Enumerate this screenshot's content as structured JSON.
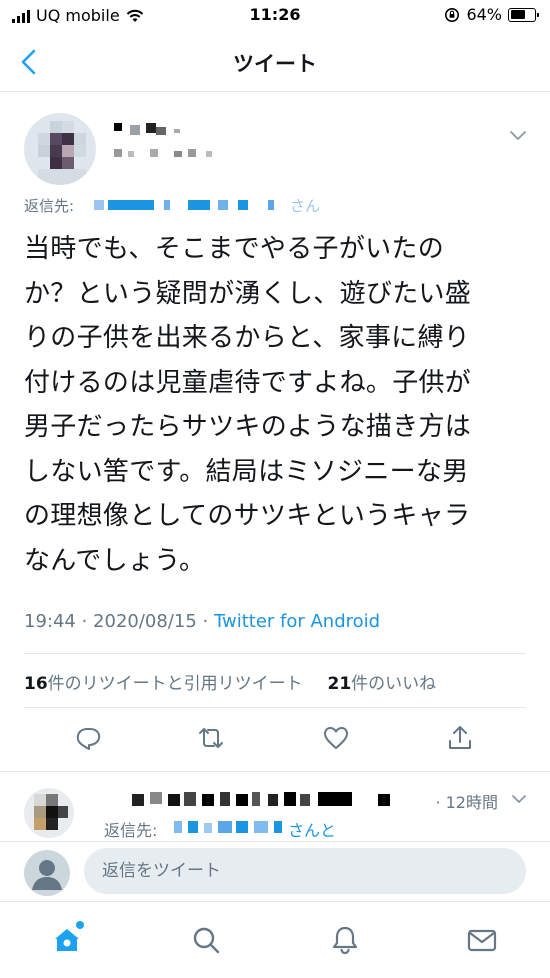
{
  "status_bar": {
    "carrier": "UQ mobile",
    "time": "11:26",
    "battery_percent_text": "64%",
    "battery_level": 0.64
  },
  "nav": {
    "title": "ツイート",
    "back_icon": "chevron-left-icon"
  },
  "tweet": {
    "reply_to_label": "返信先:",
    "reply_to_suffix": "さん",
    "text": "当時でも、そこまでやる子がいたの\nか？という疑問が湧くし、遊びたい盛\nりの子供を出来るからと、家事に縛り\n付けるのは児童虐待ですよね。子供が\n男子だったらサツキのような描き方は\nしない筈です。結局はミソジニーな男\nの理想像としてのサツキというキャラ\nなんでしょう。",
    "time": "19:44",
    "date": "2020/08/15",
    "separator": " · ",
    "source": "Twitter for Android",
    "retweet_count": "16",
    "retweet_label": "件のリツイートと引用リツイート",
    "like_count": "21",
    "like_label": "件のいいね"
  },
  "actions": [
    {
      "name": "reply",
      "icon": "reply-icon"
    },
    {
      "name": "retweet",
      "icon": "retweet-icon"
    },
    {
      "name": "like",
      "icon": "heart-icon"
    },
    {
      "name": "share",
      "icon": "share-icon"
    }
  ],
  "reply_preview": {
    "time": "· 12時間",
    "reply_to_label": "返信先:",
    "reply_to_suffix": "さんと"
  },
  "compose": {
    "placeholder": "返信をツイート"
  },
  "tabs": [
    {
      "name": "home",
      "icon": "home-icon"
    },
    {
      "name": "search",
      "icon": "search-icon"
    },
    {
      "name": "notifications",
      "icon": "bell-icon"
    },
    {
      "name": "messages",
      "icon": "mail-icon"
    }
  ],
  "colors": {
    "accent": "#1da1f2",
    "link": "#1b95e0",
    "secondary_text": "#657786",
    "primary_text": "#14171a",
    "divider": "#e1e8ed"
  }
}
